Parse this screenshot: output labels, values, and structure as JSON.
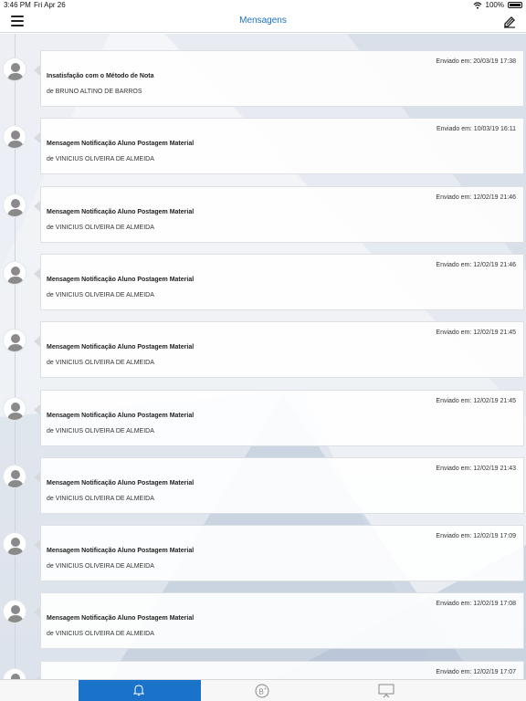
{
  "status": {
    "time": "3:46 PM",
    "date": "Fri Apr 26",
    "battery": "100%"
  },
  "header": {
    "title": "Mensagens",
    "menu_icon": "menu-icon",
    "edit_icon": "edit-icon"
  },
  "messages": [
    {
      "date": "Enviado em: 20/03/19 17:38",
      "subject": "Insatisfação com o Método de Nota",
      "from": "de BRUNO ALTINO DE BARROS"
    },
    {
      "date": "Enviado em: 10/03/19 16:11",
      "subject": "Mensagem Notificação Aluno Postagem Material",
      "from": "de VINICIUS OLIVEIRA DE ALMEIDA"
    },
    {
      "date": "Enviado em: 12/02/19 21:46",
      "subject": "Mensagem Notificação Aluno Postagem Material",
      "from": "de VINICIUS OLIVEIRA DE ALMEIDA"
    },
    {
      "date": "Enviado em: 12/02/19 21:46",
      "subject": "Mensagem Notificação Aluno Postagem Material",
      "from": "de VINICIUS OLIVEIRA DE ALMEIDA"
    },
    {
      "date": "Enviado em: 12/02/19 21:45",
      "subject": "Mensagem Notificação Aluno Postagem Material",
      "from": "de VINICIUS OLIVEIRA DE ALMEIDA"
    },
    {
      "date": "Enviado em: 12/02/19 21:45",
      "subject": "Mensagem Notificação Aluno Postagem Material",
      "from": "de VINICIUS OLIVEIRA DE ALMEIDA"
    },
    {
      "date": "Enviado em: 12/02/19 21:43",
      "subject": "Mensagem Notificação Aluno Postagem Material",
      "from": "de VINICIUS OLIVEIRA DE ALMEIDA"
    },
    {
      "date": "Enviado em: 12/02/19 17:09",
      "subject": "Mensagem Notificação Aluno Postagem Material",
      "from": "de VINICIUS OLIVEIRA DE ALMEIDA"
    },
    {
      "date": "Enviado em: 12/02/19 17:08",
      "subject": "Mensagem Notificação Aluno Postagem Material",
      "from": "de VINICIUS OLIVEIRA DE ALMEIDA"
    },
    {
      "date": "Enviado em: 12/02/19 17:07",
      "subject": "",
      "from": ""
    }
  ],
  "tabs": [
    {
      "icon": "bell-icon",
      "active": true
    },
    {
      "icon": "bplus-icon",
      "active": false
    },
    {
      "icon": "presentation-icon",
      "active": false
    }
  ],
  "colors": {
    "accent": "#1a73c8",
    "background": "#eef1f5",
    "card": "#ffffff"
  }
}
